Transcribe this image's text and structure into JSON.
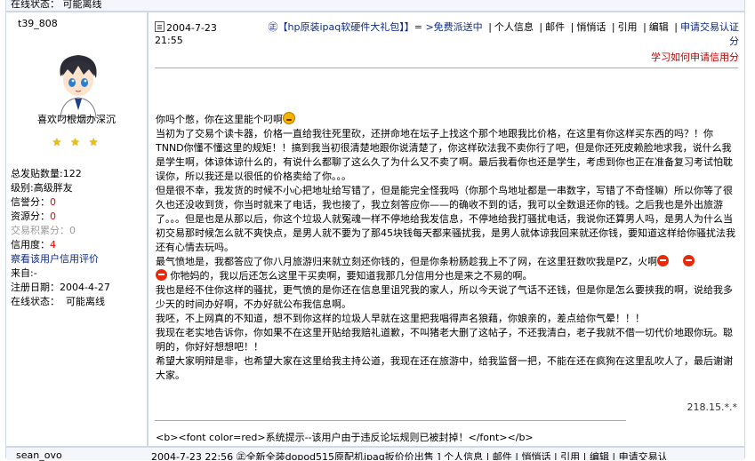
{
  "previous_post": {
    "status_label": "在线状态：",
    "status_value": "可能离线"
  },
  "user": {
    "name": "t39_808",
    "title": "喜欢叼根烟办深沉",
    "stars": "★ ★ ★",
    "posts_label": "总发贴数量:",
    "posts": "122",
    "rank_label": "级别:",
    "rank": "高级胖友",
    "wealth_label": "信誉分：",
    "wealth": "0",
    "resource_label": "资源分：",
    "resource": "0",
    "trade_label": "交易积累分：",
    "trade": "0",
    "credit_label": "信用度：",
    "credit": "4",
    "review_link": "察看该用户信用评价",
    "from_label": "来自:",
    "from": "-",
    "reg_label": "注册日期：",
    "reg": "2004-4-27",
    "status_label": "在线状态：",
    "status": "可能离线"
  },
  "post": {
    "date": "2004-7-23",
    "time": "21:55",
    "topic": "㊣【hp原装ipaq软硬件大礼包】】= >免费派送中",
    "actions": [
      "个人信息",
      "邮件",
      "悄悄话",
      "引用",
      "编辑"
    ],
    "apply_trade": "申请交易认证",
    "apply_trade_cont": "分",
    "learn_link": "学习如何申请信用分",
    "paragraph1_lead": "你吗个憋，你在这里能个叼啊",
    "paragraph1": "当初为了交易个读卡器，价格一直给我往死里砍，还拼命地在坛子上找这个那个地跟我比价格，在这里有你这样买东西的吗？！你TNND你懂不懂这里的规矩！！搞到我当初很清楚地跟你说清楚了，你这样砍法我不卖你行了吧，但是你还死皮赖脸地求我，说什么我是学生啊，体谅体谅什么的，有说什么都聊了这么久了为什么又不卖了啊。最后我看你也还是学生，考虑到你也正在准备复习考试怕耽误你，所以我还是以很低的价格卖给了你。。。",
    "paragraph2": "但是很不幸，我发货的时候不小心把地址给写错了，但是能完全怪我吗（你那个鸟地址都是一串数字，写错了不奇怪嘛）所以你等了很久也还没收到货，你当时就来了电话，我也接了，我立刻答应你——的确收不到的话，我可以全数退还你的钱。之后我也是外出旅游了。。。但是也是从那以后，你这个垃圾人就冤魂一样不停地给我发信息，不停地给我打骚扰电话，我说你还算男人吗，是男人为什么当初交易那时候怎么就不爽快点，是男人就不要为了那45块钱每天都来骚扰我，是男人就体谅我回来就还你钱，要知道这样给你骚扰法我还有心情去玩吗。",
    "paragraph3a": "最气愤地是，我都答应了你八月旅游归来就立刻还你钱的，但是你条粉肠趁我上不了网，在这里狂数吹我是PZ，火啊",
    "paragraph3b": "你牠妈的，我以后还怎么这里干买卖啊，要知道我那几分信用分也是来之不易的啊。",
    "paragraph4": "我也是经不住你这样的骚扰，更气愤的是你还在信息里诅咒我的家人，所以今天说了气话不还钱，但是你是怎么要挟我的啊，说给我多少天的时间办好啊，不办好就公布我信息啊。",
    "paragraph5": "我呸，不上网真的不知道，想不到你这样的垃圾人早就在这里把我唱得声名狼藉，你娘亲的，差点给你气晕！！！",
    "paragraph6": "我现在老实地告诉你，你如果不在这里开贴给我赔礼道歉，不叫猪老大删了这帖子，不还我清白，老子我就不借一切代价地跟你玩。聪明的，你好好想想吧！！",
    "paragraph7": "希望大家明辩是非，也希望大家在这里给我主持公道，我现在还在旅游中，给我监督一把，不能在还在疯狗在这里乱吹人了，最后谢谢大家。",
    "ip": "218.15.*.*",
    "system_line": "<b><font color=red>系统提示--该用户由于违反论坛规则已被封掉！</font></b>"
  },
  "next_post": {
    "username": "sean_ovo",
    "header": "2004-7-23 22:56    ㊣全新全装dopod515原配机ipaq扳价价出售 ]  个人信息 | 邮件 | 悄悄话 | 引用 | 编辑 | 申请交易认"
  },
  "colors": {
    "link": "#0c2a8a",
    "red": "#ff0000",
    "frame": "#cfd8e6",
    "stars": "#f0c000"
  }
}
